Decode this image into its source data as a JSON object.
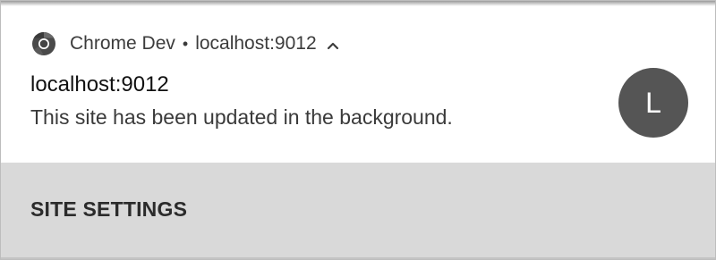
{
  "notification": {
    "app_name": "Chrome Dev",
    "separator": "•",
    "origin": "localhost:9012",
    "app_icon": "chrome-icon",
    "expand_icon": "chevron-up-icon",
    "title": "localhost:9012",
    "body": "This site has been updated in the background.",
    "avatar_letter": "L",
    "avatar_color": "#555555"
  },
  "actions": {
    "site_settings_label": "SITE SETTINGS",
    "background": "#d9d9d9"
  }
}
